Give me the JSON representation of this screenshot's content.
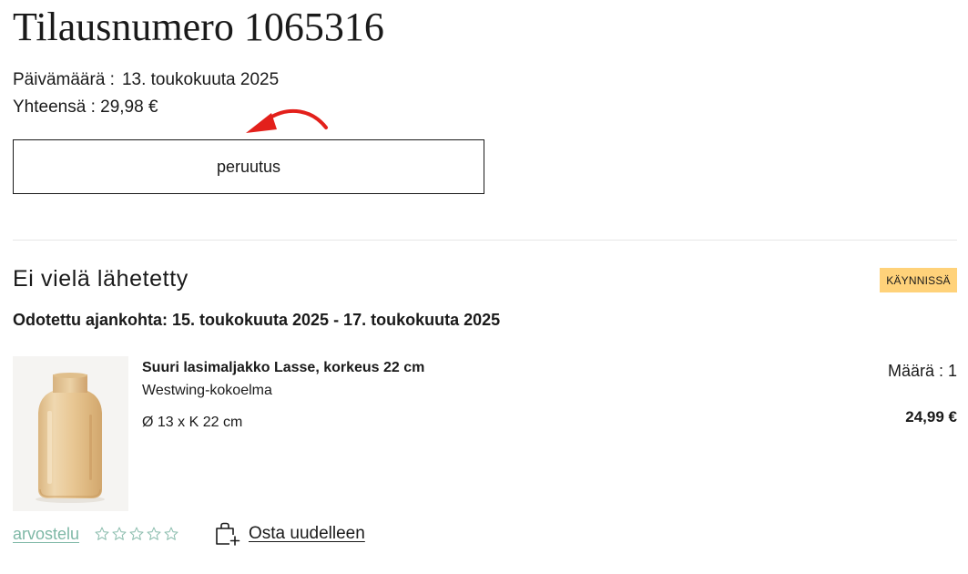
{
  "order": {
    "title": "Tilausnumero 1065316",
    "date_label": "Päivämäärä :",
    "date_value": "13. toukokuuta 2025",
    "total_label": "Yhteensä :",
    "total_value": "29,98 €"
  },
  "actions": {
    "cancel_label": "peruutus"
  },
  "shipment": {
    "title": "Ei vielä lähetetty",
    "status_badge": "KÄYNNISSÄ",
    "expected_text": "Odotettu ajankohta: 15. toukokuuta 2025 - 17. toukokuuta 2025"
  },
  "item": {
    "name": "Suuri lasimaljakko Lasse, korkeus 22 cm",
    "brand": "Westwing-kokoelma",
    "dimensions": "Ø 13 x K 22 cm",
    "quantity": "Määrä : 1",
    "price": "24,99 €",
    "image_icon": "glass-vase-image"
  },
  "review": {
    "link_label": "arvostelu",
    "rating": 0,
    "max_rating": 5,
    "star_icon": "star-outline-icon"
  },
  "reorder": {
    "label": "Osta uudelleen",
    "icon": "bag-add-icon"
  },
  "colors": {
    "badge_bg": "#ffd27a",
    "review_link": "#7fb8a6",
    "annotation_arrow": "#e3201b",
    "text": "#1a1a1a"
  }
}
